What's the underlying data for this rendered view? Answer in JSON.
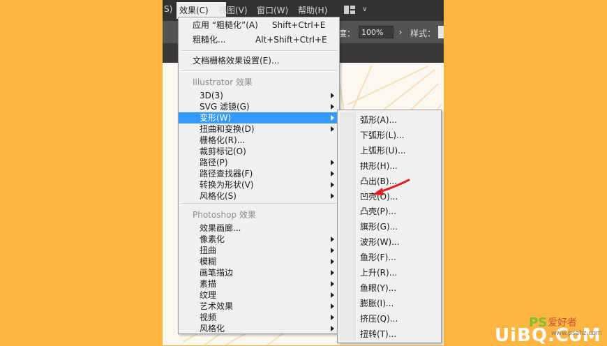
{
  "menubar": {
    "items": [
      {
        "label": "S)"
      },
      {
        "label": "效果(C)"
      },
      {
        "label": "视图(V)"
      },
      {
        "label": "窗口(W)"
      },
      {
        "label": "帮助(H)"
      }
    ]
  },
  "options_bar": {
    "opacity_label": "度：",
    "opacity_value": "100%",
    "style_label": "样式："
  },
  "effect_menu": {
    "top_items": [
      {
        "label": "应用 “粗糙化”(A)",
        "shortcut": "Shift+Ctrl+E"
      },
      {
        "label": "粗糙化...",
        "shortcut": "Alt+Shift+Ctrl+E"
      }
    ],
    "doc_raster_settings": "文档栅格效果设置(E)...",
    "illustrator_header": "Illustrator 效果",
    "illustrator_items": [
      {
        "label": "3D(3)",
        "submenu": true
      },
      {
        "label": "SVG 滤镜(G)",
        "submenu": true
      },
      {
        "label": "变形(W)",
        "submenu": true,
        "highlighted": true
      },
      {
        "label": "扭曲和变换(D)",
        "submenu": true
      },
      {
        "label": "栅格化(R)...",
        "submenu": false
      },
      {
        "label": "裁剪标记(O)",
        "submenu": false
      },
      {
        "label": "路径(P)",
        "submenu": true
      },
      {
        "label": "路径查找器(F)",
        "submenu": true
      },
      {
        "label": "转换为形状(V)",
        "submenu": true
      },
      {
        "label": "风格化(S)",
        "submenu": true
      }
    ],
    "photoshop_header": "Photoshop 效果",
    "photoshop_items": [
      {
        "label": "效果画廊...",
        "submenu": false
      },
      {
        "label": "像素化",
        "submenu": true
      },
      {
        "label": "扭曲",
        "submenu": true
      },
      {
        "label": "模糊",
        "submenu": true
      },
      {
        "label": "画笔描边",
        "submenu": true
      },
      {
        "label": "素描",
        "submenu": true
      },
      {
        "label": "纹理",
        "submenu": true
      },
      {
        "label": "艺术效果",
        "submenu": true
      },
      {
        "label": "视频",
        "submenu": true
      },
      {
        "label": "风格化",
        "submenu": true
      }
    ]
  },
  "warp_submenu": {
    "items": [
      {
        "label": "弧形(A)..."
      },
      {
        "label": "下弧形(L)..."
      },
      {
        "label": "上弧形(U)..."
      },
      {
        "label": "拱形(H)..."
      },
      {
        "label": "凸出(B)..."
      },
      {
        "label": "凹壳(O)..."
      },
      {
        "label": "凸壳(P)..."
      },
      {
        "label": "旗形(G)..."
      },
      {
        "label": "波形(W)..."
      },
      {
        "label": "鱼形(F)..."
      },
      {
        "label": "上升(R)..."
      },
      {
        "label": "鱼眼(Y)..."
      },
      {
        "label": "膨胀(I)..."
      },
      {
        "label": "挤压(Q)..."
      },
      {
        "label": "扭转(T)..."
      }
    ]
  },
  "watermark": {
    "ps": "PS",
    "cn": "爱好者",
    "site": "UiBQ.CoM",
    "small": "www.psahz.com"
  },
  "colors": {
    "background": "#fdb642",
    "highlight": "#3399ff",
    "annotation_arrow": "#e02020"
  }
}
